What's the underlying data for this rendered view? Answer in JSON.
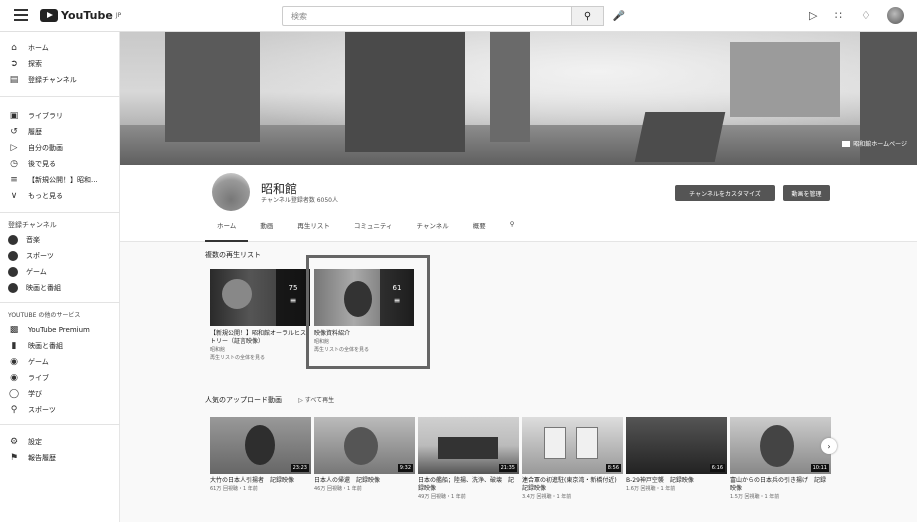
{
  "header": {
    "logo_text": "YouTube",
    "logo_sup": "JP",
    "search_placeholder": "検索"
  },
  "sidebar": {
    "main_items": [
      {
        "label": "ホーム",
        "icon": "home-icon"
      },
      {
        "label": "探索",
        "icon": "compass-icon"
      },
      {
        "label": "登録チャンネル",
        "icon": "subscriptions-icon"
      }
    ],
    "library_items": [
      {
        "label": "ライブラリ",
        "icon": "library-icon"
      },
      {
        "label": "履歴",
        "icon": "history-icon"
      },
      {
        "label": "自分の動画",
        "icon": "my-videos-icon"
      },
      {
        "label": "後で見る",
        "icon": "watch-later-icon"
      },
      {
        "label": "【新規公開！】昭和...",
        "icon": "playlist-icon"
      },
      {
        "label": "もっと見る",
        "icon": "chevron-down-icon"
      }
    ],
    "subs_title": "登録チャンネル",
    "subs_items": [
      {
        "label": "音楽"
      },
      {
        "label": "スポーツ"
      },
      {
        "label": "ゲーム"
      },
      {
        "label": "映画と番組"
      }
    ],
    "services_title": "YOUTUBE の他のサービス",
    "services_items": [
      {
        "label": "YouTube Premium",
        "icon": "premium-icon"
      },
      {
        "label": "映画と番組",
        "icon": "film-icon"
      },
      {
        "label": "ゲーム",
        "icon": "gaming-icon"
      },
      {
        "label": "ライブ",
        "icon": "live-icon"
      },
      {
        "label": "学び",
        "icon": "learning-icon"
      },
      {
        "label": "スポーツ",
        "icon": "sports-icon"
      }
    ],
    "bottom_items": [
      {
        "label": "設定",
        "icon": "settings-icon"
      },
      {
        "label": "報告履歴",
        "icon": "flag-icon"
      }
    ]
  },
  "banner": {
    "link_label": "昭和館ホームページ"
  },
  "channel": {
    "name": "昭和館",
    "subscribers": "チャンネル登録者数 6050人",
    "customize_label": "チャンネルをカスタマイズ",
    "manage_label": "動画を管理",
    "tabs": [
      "ホーム",
      "動画",
      "再生リスト",
      "コミュニティ",
      "チャンネル",
      "概要"
    ]
  },
  "playlists": {
    "title": "複数の再生リスト",
    "items": [
      {
        "count": "75",
        "title": "【新規公開！】昭和館オーラルヒストリー（証言映像）",
        "owner": "昭和館",
        "link": "再生リストの全体を見る"
      },
      {
        "count": "61",
        "title": "映像資料紹介",
        "owner": "昭和館",
        "link": "再生リストの全体を見る"
      }
    ]
  },
  "popular": {
    "title": "人気のアップロード動画",
    "play_all": "すべて再生",
    "videos": [
      {
        "title": "大竹の日本人引揚者　記録映像",
        "meta": "61万 回視聴・1 年前",
        "duration": "23:23"
      },
      {
        "title": "日本人の帰還　記録映像",
        "meta": "46万 回視聴・1 年前",
        "duration": "9:32"
      },
      {
        "title": "日本の艦船；陸揚、洗浄、破壊　記録映像",
        "meta": "49万 回視聴・1 年前",
        "duration": "21:35"
      },
      {
        "title": "連合軍の初進駐(東京湾・新橋付近)　記録映像",
        "meta": "3.4万 回視聴・1 年前",
        "duration": "8:56"
      },
      {
        "title": "B-29神戸空襲　記録映像",
        "meta": "1.6万 回視聴・1 年前",
        "duration": "6:16"
      },
      {
        "title": "富山からの日本兵の引き揚げ　記録映像",
        "meta": "1.5万 回視聴・1 年前",
        "duration": "10:11"
      }
    ]
  }
}
